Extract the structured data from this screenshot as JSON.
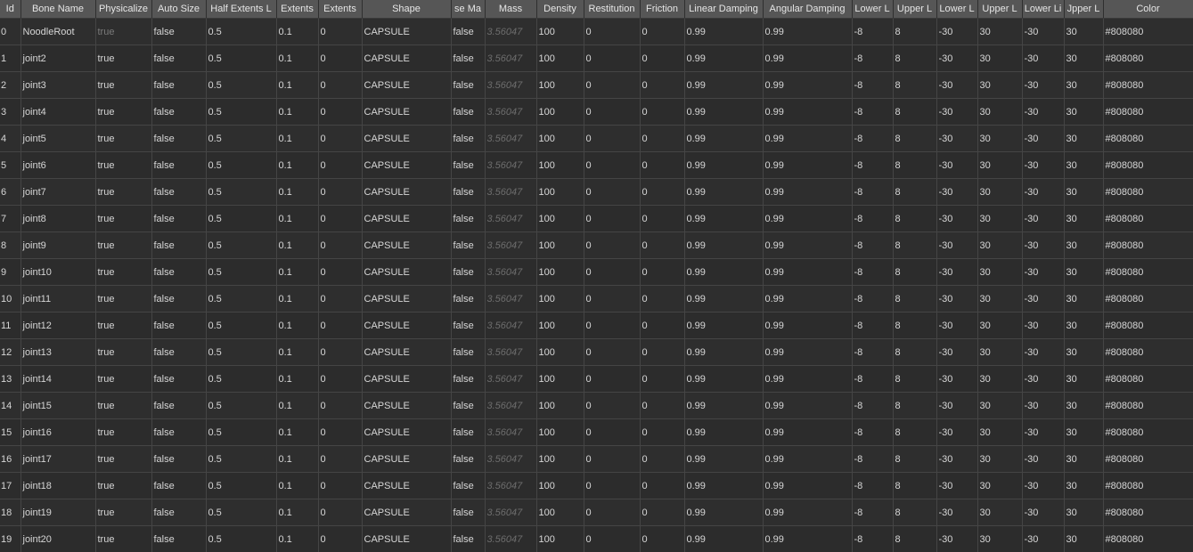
{
  "columns": [
    "Id",
    "Bone Name",
    "Physicalize",
    "Auto Size",
    "Half Extents L",
    "Extents",
    "Extents",
    "Shape",
    "se Ma",
    "Mass",
    "Density",
    "Restitution",
    "Friction",
    "Linear Damping",
    "Angular Damping",
    "Lower L",
    "Upper L",
    "Lower L",
    "Upper L",
    "Lower Li",
    "Jpper L",
    "Color"
  ],
  "rows": [
    [
      "0",
      "NoodleRoot",
      "true",
      "false",
      "0.5",
      "0.1",
      "0",
      "CAPSULE",
      "false",
      "3.56047",
      "100",
      "0",
      "0",
      "0.99",
      "0.99",
      "-8",
      "8",
      "-30",
      "30",
      "-30",
      "30",
      "#808080"
    ],
    [
      "1",
      "joint2",
      "true",
      "false",
      "0.5",
      "0.1",
      "0",
      "CAPSULE",
      "false",
      "3.56047",
      "100",
      "0",
      "0",
      "0.99",
      "0.99",
      "-8",
      "8",
      "-30",
      "30",
      "-30",
      "30",
      "#808080"
    ],
    [
      "2",
      "joint3",
      "true",
      "false",
      "0.5",
      "0.1",
      "0",
      "CAPSULE",
      "false",
      "3.56047",
      "100",
      "0",
      "0",
      "0.99",
      "0.99",
      "-8",
      "8",
      "-30",
      "30",
      "-30",
      "30",
      "#808080"
    ],
    [
      "3",
      "joint4",
      "true",
      "false",
      "0.5",
      "0.1",
      "0",
      "CAPSULE",
      "false",
      "3.56047",
      "100",
      "0",
      "0",
      "0.99",
      "0.99",
      "-8",
      "8",
      "-30",
      "30",
      "-30",
      "30",
      "#808080"
    ],
    [
      "4",
      "joint5",
      "true",
      "false",
      "0.5",
      "0.1",
      "0",
      "CAPSULE",
      "false",
      "3.56047",
      "100",
      "0",
      "0",
      "0.99",
      "0.99",
      "-8",
      "8",
      "-30",
      "30",
      "-30",
      "30",
      "#808080"
    ],
    [
      "5",
      "joint6",
      "true",
      "false",
      "0.5",
      "0.1",
      "0",
      "CAPSULE",
      "false",
      "3.56047",
      "100",
      "0",
      "0",
      "0.99",
      "0.99",
      "-8",
      "8",
      "-30",
      "30",
      "-30",
      "30",
      "#808080"
    ],
    [
      "6",
      "joint7",
      "true",
      "false",
      "0.5",
      "0.1",
      "0",
      "CAPSULE",
      "false",
      "3.56047",
      "100",
      "0",
      "0",
      "0.99",
      "0.99",
      "-8",
      "8",
      "-30",
      "30",
      "-30",
      "30",
      "#808080"
    ],
    [
      "7",
      "joint8",
      "true",
      "false",
      "0.5",
      "0.1",
      "0",
      "CAPSULE",
      "false",
      "3.56047",
      "100",
      "0",
      "0",
      "0.99",
      "0.99",
      "-8",
      "8",
      "-30",
      "30",
      "-30",
      "30",
      "#808080"
    ],
    [
      "8",
      "joint9",
      "true",
      "false",
      "0.5",
      "0.1",
      "0",
      "CAPSULE",
      "false",
      "3.56047",
      "100",
      "0",
      "0",
      "0.99",
      "0.99",
      "-8",
      "8",
      "-30",
      "30",
      "-30",
      "30",
      "#808080"
    ],
    [
      "9",
      "joint10",
      "true",
      "false",
      "0.5",
      "0.1",
      "0",
      "CAPSULE",
      "false",
      "3.56047",
      "100",
      "0",
      "0",
      "0.99",
      "0.99",
      "-8",
      "8",
      "-30",
      "30",
      "-30",
      "30",
      "#808080"
    ],
    [
      "10",
      "joint11",
      "true",
      "false",
      "0.5",
      "0.1",
      "0",
      "CAPSULE",
      "false",
      "3.56047",
      "100",
      "0",
      "0",
      "0.99",
      "0.99",
      "-8",
      "8",
      "-30",
      "30",
      "-30",
      "30",
      "#808080"
    ],
    [
      "11",
      "joint12",
      "true",
      "false",
      "0.5",
      "0.1",
      "0",
      "CAPSULE",
      "false",
      "3.56047",
      "100",
      "0",
      "0",
      "0.99",
      "0.99",
      "-8",
      "8",
      "-30",
      "30",
      "-30",
      "30",
      "#808080"
    ],
    [
      "12",
      "joint13",
      "true",
      "false",
      "0.5",
      "0.1",
      "0",
      "CAPSULE",
      "false",
      "3.56047",
      "100",
      "0",
      "0",
      "0.99",
      "0.99",
      "-8",
      "8",
      "-30",
      "30",
      "-30",
      "30",
      "#808080"
    ],
    [
      "13",
      "joint14",
      "true",
      "false",
      "0.5",
      "0.1",
      "0",
      "CAPSULE",
      "false",
      "3.56047",
      "100",
      "0",
      "0",
      "0.99",
      "0.99",
      "-8",
      "8",
      "-30",
      "30",
      "-30",
      "30",
      "#808080"
    ],
    [
      "14",
      "joint15",
      "true",
      "false",
      "0.5",
      "0.1",
      "0",
      "CAPSULE",
      "false",
      "3.56047",
      "100",
      "0",
      "0",
      "0.99",
      "0.99",
      "-8",
      "8",
      "-30",
      "30",
      "-30",
      "30",
      "#808080"
    ],
    [
      "15",
      "joint16",
      "true",
      "false",
      "0.5",
      "0.1",
      "0",
      "CAPSULE",
      "false",
      "3.56047",
      "100",
      "0",
      "0",
      "0.99",
      "0.99",
      "-8",
      "8",
      "-30",
      "30",
      "-30",
      "30",
      "#808080"
    ],
    [
      "16",
      "joint17",
      "true",
      "false",
      "0.5",
      "0.1",
      "0",
      "CAPSULE",
      "false",
      "3.56047",
      "100",
      "0",
      "0",
      "0.99",
      "0.99",
      "-8",
      "8",
      "-30",
      "30",
      "-30",
      "30",
      "#808080"
    ],
    [
      "17",
      "joint18",
      "true",
      "false",
      "0.5",
      "0.1",
      "0",
      "CAPSULE",
      "false",
      "3.56047",
      "100",
      "0",
      "0",
      "0.99",
      "0.99",
      "-8",
      "8",
      "-30",
      "30",
      "-30",
      "30",
      "#808080"
    ],
    [
      "18",
      "joint19",
      "true",
      "false",
      "0.5",
      "0.1",
      "0",
      "CAPSULE",
      "false",
      "3.56047",
      "100",
      "0",
      "0",
      "0.99",
      "0.99",
      "-8",
      "8",
      "-30",
      "30",
      "-30",
      "30",
      "#808080"
    ],
    [
      "19",
      "joint20",
      "true",
      "false",
      "0.5",
      "0.1",
      "0",
      "CAPSULE",
      "false",
      "3.56047",
      "100",
      "0",
      "0",
      "0.99",
      "0.99",
      "-8",
      "8",
      "-30",
      "30",
      "-30",
      "30",
      "#808080"
    ]
  ]
}
